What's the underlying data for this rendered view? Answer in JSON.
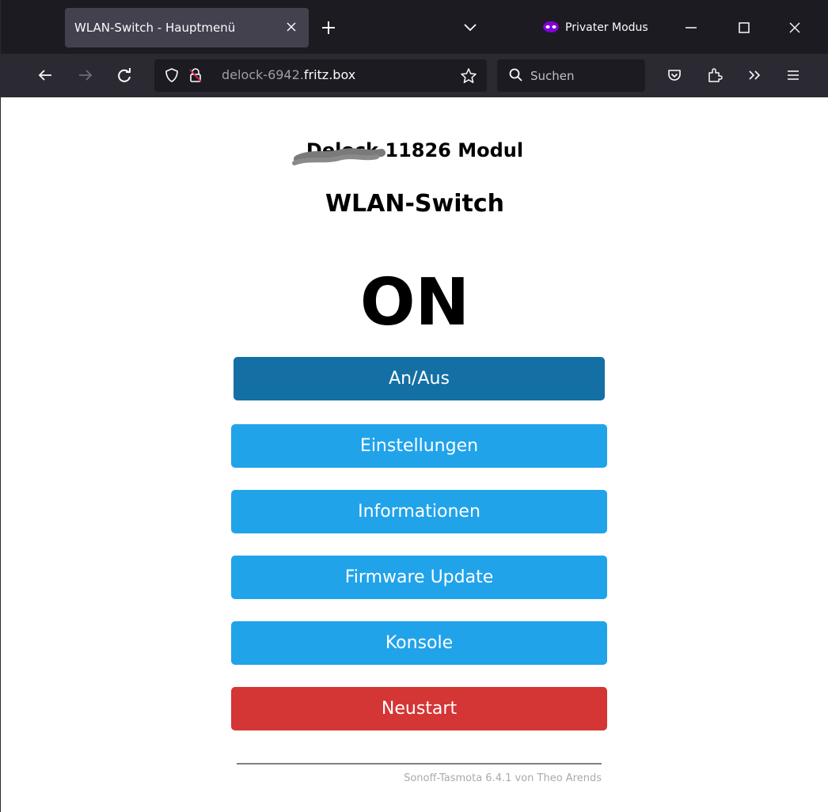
{
  "browser": {
    "tab": {
      "title": "WLAN-Switch - Hauptmenü"
    },
    "private_mode_label": "Privater Modus",
    "url": {
      "subdomain": "delock-6942.",
      "domain": "fritz.box"
    },
    "search": {
      "placeholder": "Suchen"
    }
  },
  "page": {
    "device_title": "Delock 11826 Modul",
    "title": "WLAN-Switch",
    "power_state": "ON",
    "buttons": {
      "toggle": "An/Aus",
      "config": "Einstellungen",
      "info": "Informationen",
      "firmware_update": "Firmware Update",
      "console": "Konsole",
      "restart": "Neustart"
    },
    "footer": "Sonoff-Tasmota 6.4.1 von Theo Arends"
  },
  "colors": {
    "toggle_button": "#1470a4",
    "menu_button": "#21a3ea",
    "restart_button": "#d43535",
    "private_icon": "#8000d7"
  },
  "icons": [
    "close-icon",
    "plus-icon",
    "chevron-down-icon",
    "private-mask-icon",
    "minimize-icon",
    "maximize-icon",
    "arrow-left-icon",
    "arrow-right-icon",
    "reload-icon",
    "shield-icon",
    "insecure-lock-icon",
    "star-icon",
    "search-icon",
    "pocket-icon",
    "extensions-icon",
    "chevron-double-right-icon",
    "hamburger-menu-icon"
  ]
}
